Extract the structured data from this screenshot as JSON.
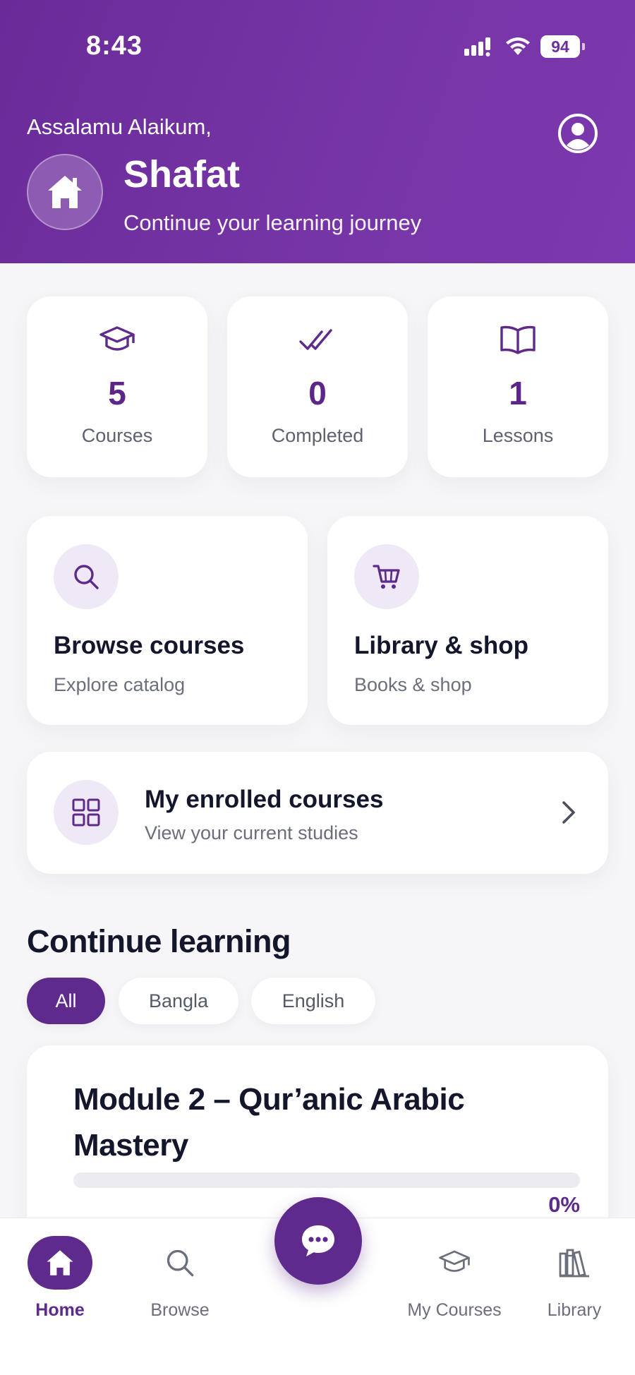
{
  "status_bar": {
    "time": "8:43",
    "battery": "94"
  },
  "header": {
    "greeting": "Assalamu Alaikum,",
    "user_name": "Shafat",
    "subtitle": "Continue your learning journey",
    "profile_icon": "user-circle-icon",
    "home_icon": "home-icon"
  },
  "stats": [
    {
      "icon": "graduation-cap-icon",
      "value": "5",
      "label": "Courses"
    },
    {
      "icon": "double-check-icon",
      "value": "0",
      "label": "Completed"
    },
    {
      "icon": "open-book-icon",
      "value": "1",
      "label": "Lessons"
    }
  ],
  "actions": [
    {
      "icon": "search-icon",
      "title": "Browse courses",
      "subtitle": "Explore catalog"
    },
    {
      "icon": "cart-icon",
      "title": "Library & shop",
      "subtitle": "Books & shop"
    }
  ],
  "enrolled": {
    "icon": "grid-icon",
    "title": "My enrolled courses",
    "subtitle": "View your current studies"
  },
  "continue_learning": {
    "title": "Continue learning",
    "filters": [
      "All",
      "Bangla",
      "English"
    ],
    "active_filter": "All",
    "course": {
      "title": "Module 2 – Qur’anic Arabic Mastery",
      "progress": 0,
      "progress_label": "0%"
    }
  },
  "tabbar": {
    "tabs": [
      {
        "label": "Home",
        "icon": "home-icon",
        "active": true
      },
      {
        "label": "Browse",
        "icon": "search-icon",
        "active": false
      },
      {
        "label": "My Courses",
        "icon": "graduation-cap-icon",
        "active": false
      },
      {
        "label": "Library",
        "icon": "books-icon",
        "active": false
      }
    ],
    "fab_icon": "chat-bubble-icon"
  },
  "colors": {
    "brand": "#5e2a8c",
    "header": "#7232a3",
    "accent_soft": "#efe8f6"
  }
}
